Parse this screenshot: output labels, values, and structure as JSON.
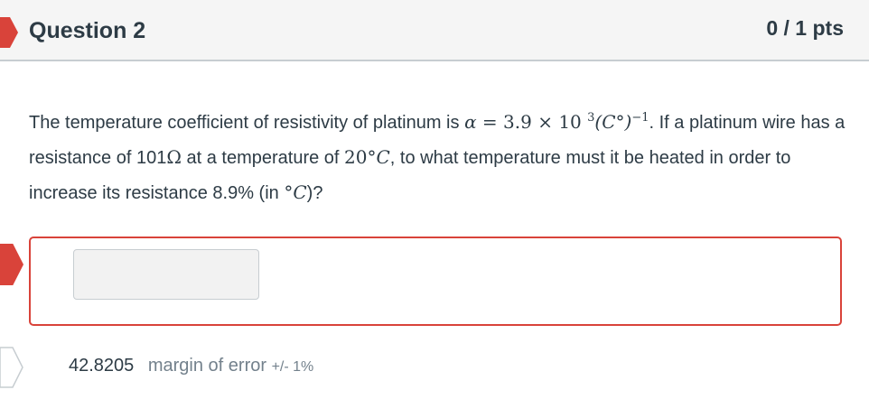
{
  "header": {
    "title": "Question 2",
    "points": "0 / 1 pts"
  },
  "question": {
    "seg1": "The temperature coefficient of resistivity of  platinum is ",
    "alpha": "α",
    "eq": " = 3.9 × 10 ",
    "exp1": "3",
    "unit1": "(C°)",
    "exp2": "−1",
    "seg2": ". If a platinum wire has a resistance of  101",
    "ohm": "Ω",
    "seg3": " at a temperature of ",
    "temp": "20°",
    "tempC": "C",
    "seg4": ",  to what temperature must it be heated in order to increase its resistance  8.9%  (in ",
    "deg": "°",
    "inC": "C",
    "seg5": ")?"
  },
  "answer": {
    "input_value": ""
  },
  "correct": {
    "value": "42.8205",
    "margin_label": "margin of error",
    "margin_value": "+/- 1%"
  },
  "colors": {
    "incorrect": "#d9433a",
    "header_bg": "#f5f5f5",
    "text": "#2d3b45"
  }
}
